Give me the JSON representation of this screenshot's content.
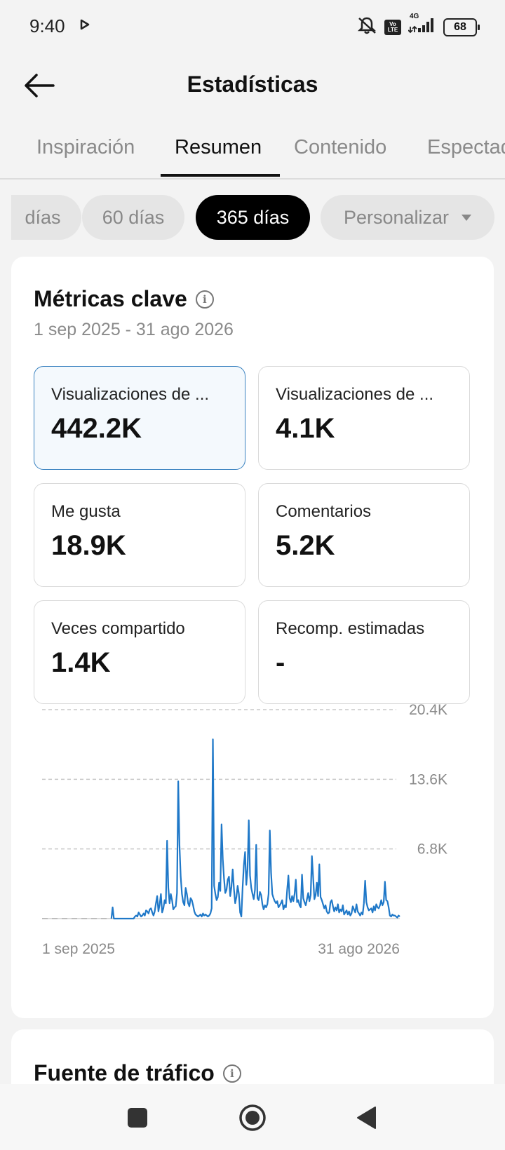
{
  "status_bar": {
    "time": "9:40",
    "battery": "68",
    "network": "4G",
    "volte": "Vo LTE"
  },
  "header": {
    "title": "Estadísticas"
  },
  "tabs": [
    {
      "label": "Inspiración"
    },
    {
      "label": "Resumen"
    },
    {
      "label": "Contenido"
    },
    {
      "label": "Espectadores"
    }
  ],
  "active_tab": "Resumen",
  "ranges": [
    {
      "label": "días"
    },
    {
      "label": "60 días"
    },
    {
      "label": "365 días"
    },
    {
      "label": "Personalizar"
    }
  ],
  "active_range": "365 días",
  "key_metrics": {
    "title": "Métricas clave",
    "date_range": "1 sep 2025 - 31 ago 2026",
    "items": [
      {
        "label": "Visualizaciones de ...",
        "value": "442.2K",
        "selected": true
      },
      {
        "label": "Visualizaciones de ...",
        "value": "4.1K"
      },
      {
        "label": "Me gusta",
        "value": "18.9K"
      },
      {
        "label": "Comentarios",
        "value": "5.2K"
      },
      {
        "label": "Veces compartido",
        "value": "1.4K"
      },
      {
        "label": "Recomp. estimadas",
        "value": "-"
      }
    ]
  },
  "chart_data": {
    "type": "line",
    "x_start_label": "1 sep 2025",
    "x_end_label": "31 ago 2026",
    "y_ticks": [
      "6.8K",
      "13.6K",
      "20.4K"
    ],
    "y_tick_values": [
      6800,
      13600,
      20400
    ],
    "ylim": [
      0,
      20400
    ],
    "grid": true,
    "color": "#1f78c8",
    "values": [
      0,
      0,
      0,
      0,
      0,
      0,
      0,
      0,
      0,
      0,
      0,
      0,
      0,
      0,
      0,
      0,
      0,
      0,
      0,
      0,
      0,
      0,
      0,
      0,
      0,
      0,
      0,
      0,
      0,
      0,
      0,
      0,
      0,
      0,
      0,
      0,
      0,
      0,
      0,
      0,
      0,
      0,
      0,
      0,
      0,
      0,
      0,
      0,
      0,
      0,
      0,
      0,
      0,
      0,
      0,
      0,
      0,
      1100,
      0,
      0,
      0,
      0,
      0,
      0,
      0,
      0,
      0,
      0,
      0,
      0,
      0,
      0,
      0,
      0,
      0,
      200,
      300,
      200,
      600,
      400,
      200,
      300,
      500,
      300,
      800,
      700,
      500,
      900,
      1000,
      600,
      300,
      700,
      1500,
      2200,
      700,
      1400,
      2400,
      600,
      1000,
      1800,
      1500,
      7600,
      3000,
      1500,
      2400,
      1800,
      900,
      1100,
      1200,
      2500,
      13400,
      7200,
      4100,
      2400,
      1600,
      1300,
      3000,
      2400,
      1500,
      1200,
      2000,
      1800,
      1300,
      700,
      400,
      300,
      200,
      300,
      400,
      200,
      500,
      300,
      400,
      300,
      200,
      300,
      500,
      1000,
      17500,
      3200,
      2400,
      1800,
      2100,
      3500,
      2700,
      9200,
      5800,
      3900,
      2500,
      2800,
      3800,
      4100,
      2200,
      3100,
      4800,
      2900,
      1500,
      2100,
      3200,
      2400,
      600,
      200,
      3000,
      5200,
      6500,
      3300,
      4800,
      9600,
      4200,
      3000,
      2400,
      1900,
      2800,
      7200,
      2000,
      1800,
      2600,
      2300,
      1400,
      900,
      1300,
      1100,
      1400,
      2400,
      8600,
      4500,
      2400,
      2000,
      1700,
      1500,
      1700,
      1100,
      1300,
      1500,
      1800,
      900,
      1300,
      1100,
      2800,
      4200,
      2000,
      1600,
      2200,
      1700,
      2400,
      3800,
      1600,
      1800,
      1300,
      1100,
      4300,
      2000,
      1600,
      1300,
      1900,
      2500,
      1700,
      2300,
      6100,
      4000,
      1900,
      2300,
      3500,
      2200,
      5300,
      2100,
      1800,
      1400,
      1000,
      1300,
      700,
      500,
      600,
      1600,
      1800,
      1200,
      700,
      1100,
      800,
      1400,
      600,
      900,
      700,
      1300,
      400,
      600,
      800,
      400,
      700,
      300,
      500,
      1200,
      900,
      600,
      1400,
      700,
      500,
      300,
      600,
      400,
      1500,
      3700,
      1600,
      1100,
      800,
      900,
      1000,
      600,
      1200,
      800,
      1400,
      1100,
      1000,
      1300,
      1800,
      1300,
      1600,
      3600,
      1800,
      1700,
      1100,
      300,
      200,
      400,
      300,
      300,
      200,
      100,
      300,
      200
    ]
  },
  "traffic_source": {
    "title": "Fuente de tráfico"
  },
  "navbar": {
    "items": [
      "recents",
      "home",
      "back"
    ]
  }
}
